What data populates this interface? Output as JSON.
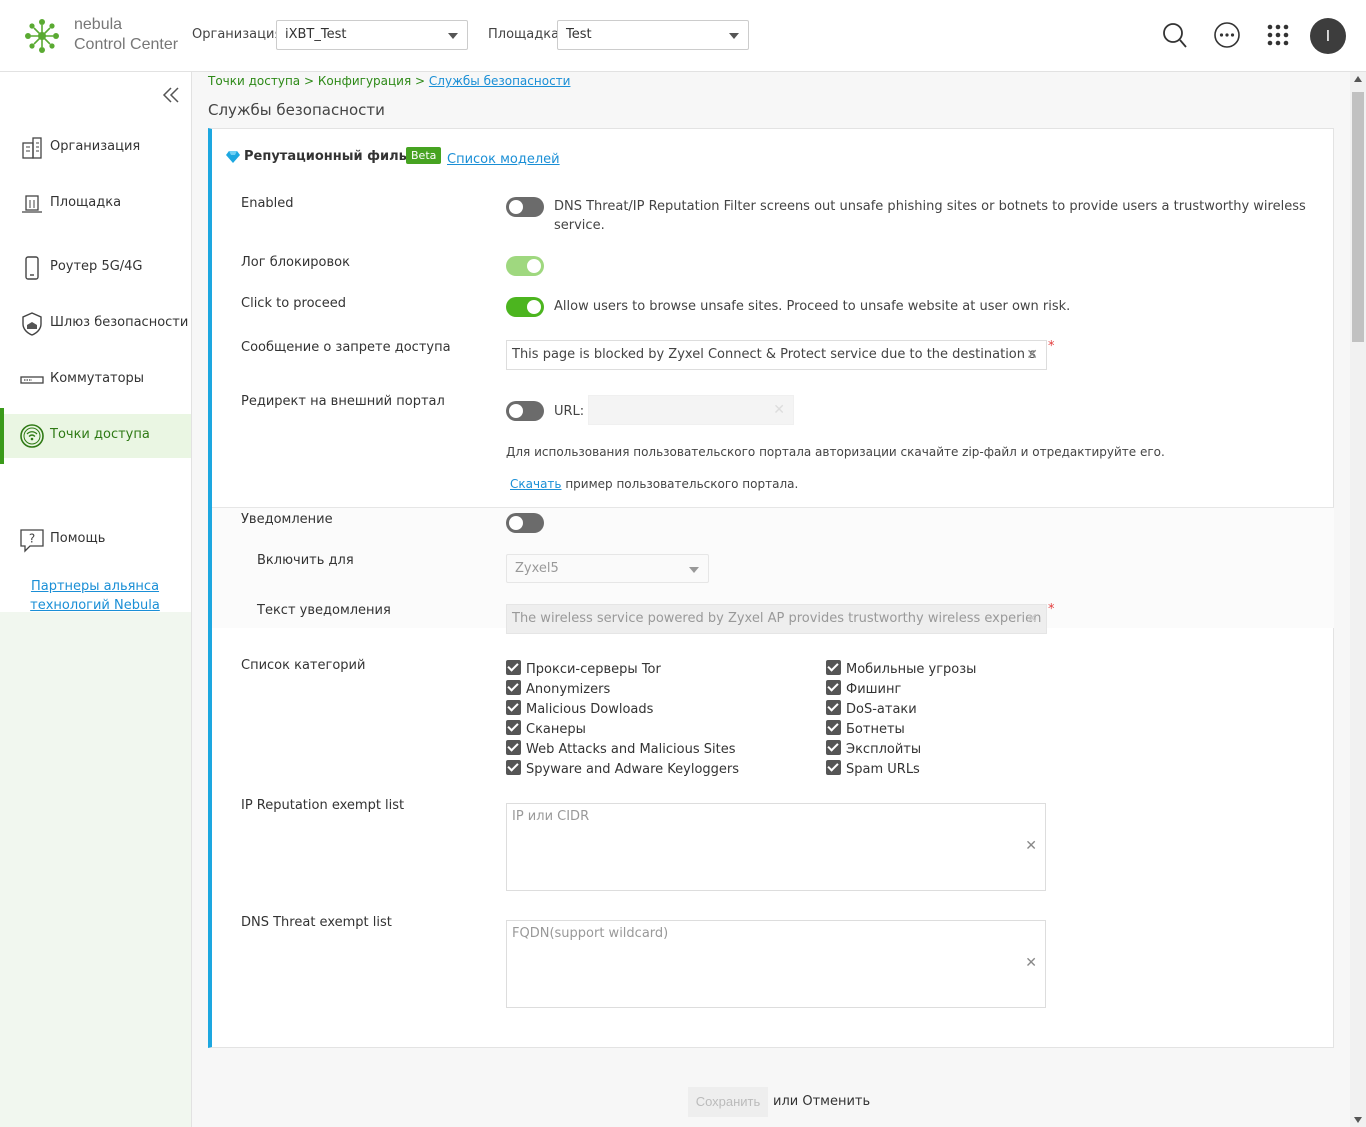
{
  "app": {
    "brand_line1": "nebula",
    "brand_line2": "Control Center",
    "org_label": "Организация:",
    "org_value": "iXBT_Test",
    "site_label": "Площадка:",
    "site_value": "Test",
    "avatar_initial": "I"
  },
  "sidebar": {
    "items": [
      {
        "label": "Организация"
      },
      {
        "label": "Площадка"
      },
      {
        "label": "Роутер 5G/4G"
      },
      {
        "label": "Шлюз безопасности"
      },
      {
        "label": "Коммутаторы"
      },
      {
        "label": "Точки доступа"
      },
      {
        "label": "Помощь"
      }
    ],
    "partners_link": "Партнеры альянса технологий Nebula"
  },
  "breadcrumb": {
    "part1": "Точки доступа",
    "part2": "Конфигурация",
    "current": "Службы безопасности"
  },
  "page": {
    "title": "Службы безопасности"
  },
  "card": {
    "title": "Репутационный фильтр",
    "badge": "Beta",
    "model_link": "Список моделей",
    "enabled_label": "Enabled",
    "enabled_desc": "DNS Threat/IP Reputation Filter screens out unsafe phishing sites or botnets to provide users a trustworthy wireless service.",
    "log_label": "Лог блокировок",
    "click_label": "Click to proceed",
    "click_desc": "Allow users to browse unsafe sites. Proceed to unsafe website at user own risk.",
    "deny_msg_label": "Сообщение о запрете доступа",
    "deny_msg_value": "This page is blocked by Zyxel Connect & Protect service due to the destination s",
    "redirect_label": "Редирект на внешний портал",
    "url_label": "URL:",
    "portal_hint": "Для использования пользовательского портала авторизации скачайте zip-файл и отредактируйте его.",
    "download_link": "Скачать",
    "download_suffix": "пример пользовательского портала.",
    "notify_label": "Уведомление",
    "enable_for_label": "Включить для",
    "enable_for_value": "Zyxel5",
    "notify_text_label": "Текст уведомления",
    "notify_text_value": "The wireless service powered by Zyxel AP provides trustworthy wireless experien",
    "categories_label": "Список категорий",
    "categories_left": [
      "Прокси-серверы Tor",
      "Anonymizers",
      "Malicious Dowloads",
      "Сканеры",
      "Web Attacks and Malicious Sites",
      "Spyware and Adware Keyloggers"
    ],
    "categories_right": [
      "Мобильные угрозы",
      "Фишинг",
      "DoS-атаки",
      "Ботнеты",
      "Эксплойты",
      "Spam URLs"
    ],
    "ip_exempt_label": "IP Reputation exempt list",
    "ip_exempt_placeholder": "IP или CIDR",
    "dns_exempt_label": "DNS Threat exempt list",
    "dns_exempt_placeholder": "FQDN(support wildcard)"
  },
  "actions": {
    "save": "Сохранить",
    "or_cancel": "или Отменить"
  },
  "colors": {
    "accent_green": "#4cb51f",
    "link_blue": "#1a8fd6",
    "card_border_blue": "#1da7e0"
  }
}
